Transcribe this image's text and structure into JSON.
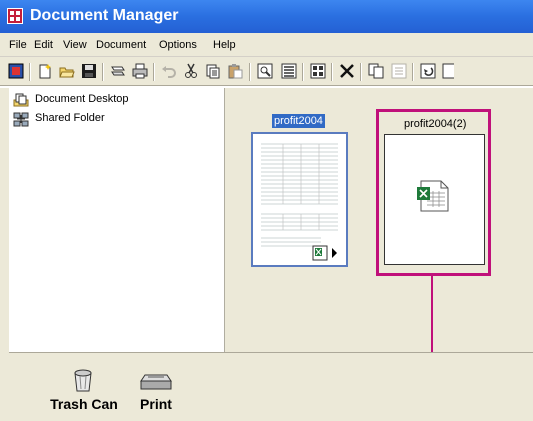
{
  "window": {
    "title": "Document Manager"
  },
  "menu": [
    "File",
    "Edit",
    "View",
    "Document",
    "Options",
    "Help"
  ],
  "toolbar": {
    "icons": [
      "app-doc-icon",
      "new-icon",
      "open-icon",
      "save-icon",
      "print-setup-icon",
      "print-icon",
      "undo-icon",
      "cut-icon",
      "copy-icon",
      "paste-icon",
      "zoom-icon",
      "details-view-icon",
      "thumbnails-view-icon",
      "delete-icon",
      "duplicate-icon",
      "properties-icon",
      "rotate-icon"
    ]
  },
  "tree": {
    "items": [
      {
        "label": "Document Desktop",
        "icon": "desktop-icon"
      },
      {
        "label": "Shared Folder",
        "icon": "network-folder-icon"
      }
    ]
  },
  "desktop": {
    "documents": [
      {
        "label": "profit2004",
        "selected_label": true
      },
      {
        "label": "profit2004(2)",
        "selected_label": false
      }
    ]
  },
  "bottom": {
    "items": [
      {
        "label": "Trash Can",
        "icon": "trash-can-icon"
      },
      {
        "label": "Print",
        "icon": "printer-icon"
      }
    ]
  },
  "colors": {
    "titlebar": "#2a6fe0",
    "highlight": "#c0107a",
    "selection": "#316ac5"
  }
}
